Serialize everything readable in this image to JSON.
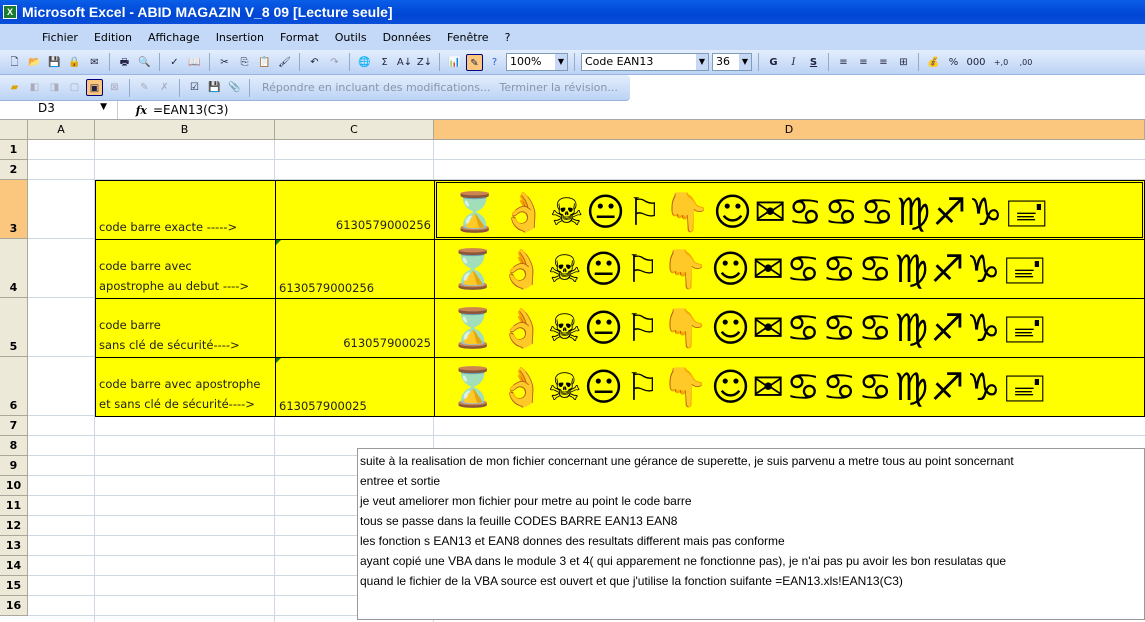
{
  "window": {
    "title": "Microsoft Excel - ABID MAGAZIN V_8 09  [Lecture seule]",
    "app_icon": "excel-icon"
  },
  "menu": [
    "Fichier",
    "Edition",
    "Affichage",
    "Insertion",
    "Format",
    "Outils",
    "Données",
    "Fenêtre",
    "?"
  ],
  "toolbar": {
    "zoom": "100%",
    "font": "Code EAN13",
    "size": "36",
    "bold": "G",
    "italic": "I",
    "strike": "S",
    "percent": "%",
    "thousands": "000",
    "inc_dec": "+,0",
    "dec_dec": ",00"
  },
  "review_toolbar": {
    "reply": "Répondre en incluant des modifications...",
    "end_review": "Terminer la révision..."
  },
  "formula_bar": {
    "cell": "D3",
    "fx": "fx",
    "formula": "=EAN13(C3)"
  },
  "columns": [
    "A",
    "B",
    "C",
    "D"
  ],
  "rows": [
    "1",
    "2",
    "3",
    "4",
    "5",
    "6",
    "7",
    "8",
    "9",
    "10",
    "11",
    "12",
    "13",
    "14",
    "15",
    "16"
  ],
  "cells": [
    {
      "b": [
        "code barre exacte ----->"
      ],
      "c": "6130579000256",
      "c_left": false
    },
    {
      "b": [
        "code barre avec",
        "apostrophe au debut ---->"
      ],
      "c": "6130579000256",
      "c_left": true
    },
    {
      "b": [
        "code barre",
        "sans clé de sécurité---->"
      ],
      "c": "613057900025",
      "c_left": false
    },
    {
      "b": [
        "code barre avec apostrophe",
        "et sans clé de sécurité---->"
      ],
      "c": "613057900025",
      "c_left": true
    }
  ],
  "barcode_glyphs": "⌛👌☠😐⚐👇☺✉♋♋♋♍♐♑🖃",
  "textbox": [
    "suite  à la realisation de mon fichier concernant une gérance de superette, je suis parvenu a metre tous au point soncernant",
    "entree et sortie",
    "je veut ameliorer mon fichier pour metre au point le code barre",
    "tous se passe dans la feuille CODES BARRE EAN13 EAN8",
    "les fonction s EAN13 et EAN8 donnes des resultats different mais pas conforme",
    "ayant copié une VBA dans le module 3  et  4( qui apparement ne fonctionne pas), je n'ai pas pu avoir les bon resulatas que",
    "quand le fichier de la VBA source est ouvert et que j'utilise la fonction suifante  =EAN13.xls!EAN13(C3)"
  ]
}
